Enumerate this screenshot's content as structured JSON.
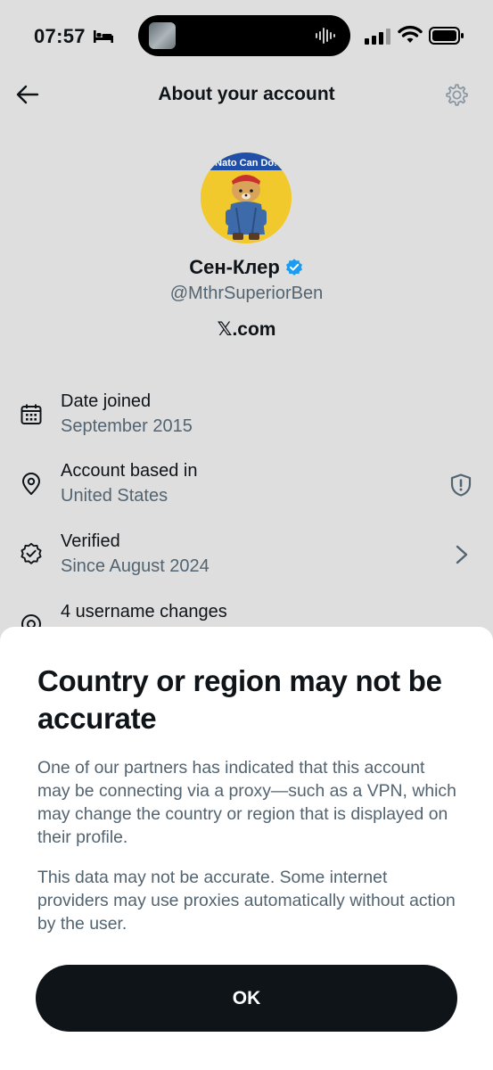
{
  "status_bar": {
    "time": "07:57",
    "icons": [
      "bed-icon",
      "signal-icon",
      "wifi-icon",
      "battery-icon"
    ]
  },
  "nav": {
    "title": "About your account",
    "icons": [
      "back-arrow-icon",
      "gear-icon"
    ]
  },
  "profile": {
    "name": "Сен-Клер",
    "handle": "@MthrSuperiorBen",
    "site": "𝕏.com",
    "avatar_banner_text": "Nato Can Do!",
    "accent": "#1d9bf0"
  },
  "info_rows": [
    {
      "label": "Date joined",
      "value": "September 2015",
      "icon": "calendar-icon"
    },
    {
      "label": "Account based in",
      "value": "United States",
      "icon": "location-pin-icon"
    },
    {
      "label": "Verified",
      "value": "Since August 2024",
      "icon": "verified-outline-icon"
    },
    {
      "label": "4 username changes",
      "value": "",
      "icon": "at-sign-icon"
    }
  ],
  "sheet": {
    "title": "Country or region may not be accurate",
    "paragraph1": "One of our partners has indicated that this account may be connecting via a proxy—such as a VPN, which may change the country or region that is displayed on their profile.",
    "paragraph2": "This data may not be accurate. Some internet providers may use proxies automatically without action by the user.",
    "ok_label": "OK"
  }
}
